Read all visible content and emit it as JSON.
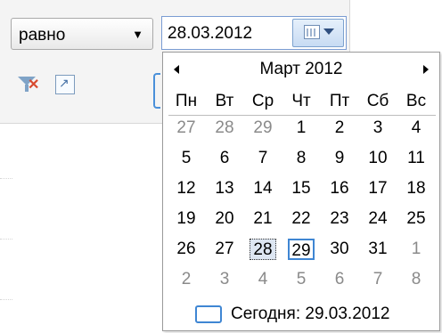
{
  "filter": {
    "operator": "равно",
    "date_value": "28.03.2012"
  },
  "icons": {
    "dropdown": "chevron-down-icon",
    "calendar": "calendar-icon",
    "clear_filter": "filter-clear-icon",
    "expand": "expand-icon",
    "prev": "chevron-left-icon",
    "next": "chevron-right-icon"
  },
  "calendar": {
    "month_title": "Март 2012",
    "weekdays": [
      "Пн",
      "Вт",
      "Ср",
      "Чт",
      "Пт",
      "Сб",
      "Вс"
    ],
    "weeks": [
      [
        {
          "d": "27",
          "other": true
        },
        {
          "d": "28",
          "other": true
        },
        {
          "d": "29",
          "other": true
        },
        {
          "d": "1"
        },
        {
          "d": "2"
        },
        {
          "d": "3"
        },
        {
          "d": "4"
        }
      ],
      [
        {
          "d": "5"
        },
        {
          "d": "6"
        },
        {
          "d": "7"
        },
        {
          "d": "8"
        },
        {
          "d": "9"
        },
        {
          "d": "10"
        },
        {
          "d": "11"
        }
      ],
      [
        {
          "d": "12"
        },
        {
          "d": "13"
        },
        {
          "d": "14"
        },
        {
          "d": "15"
        },
        {
          "d": "16"
        },
        {
          "d": "17"
        },
        {
          "d": "18"
        }
      ],
      [
        {
          "d": "19"
        },
        {
          "d": "20"
        },
        {
          "d": "21"
        },
        {
          "d": "22"
        },
        {
          "d": "23"
        },
        {
          "d": "24"
        },
        {
          "d": "25"
        }
      ],
      [
        {
          "d": "26"
        },
        {
          "d": "27"
        },
        {
          "d": "28",
          "selected": true
        },
        {
          "d": "29",
          "today": true
        },
        {
          "d": "30"
        },
        {
          "d": "31"
        },
        {
          "d": "1",
          "other": true
        }
      ],
      [
        {
          "d": "2",
          "other": true
        },
        {
          "d": "3",
          "other": true
        },
        {
          "d": "4",
          "other": true
        },
        {
          "d": "5",
          "other": true
        },
        {
          "d": "6",
          "other": true
        },
        {
          "d": "7",
          "other": true
        },
        {
          "d": "8",
          "other": true
        }
      ]
    ],
    "today_label": "Сегодня: 29.03.2012"
  },
  "colors": {
    "accent": "#3f86d3",
    "other_month": "#8a8a8a"
  }
}
